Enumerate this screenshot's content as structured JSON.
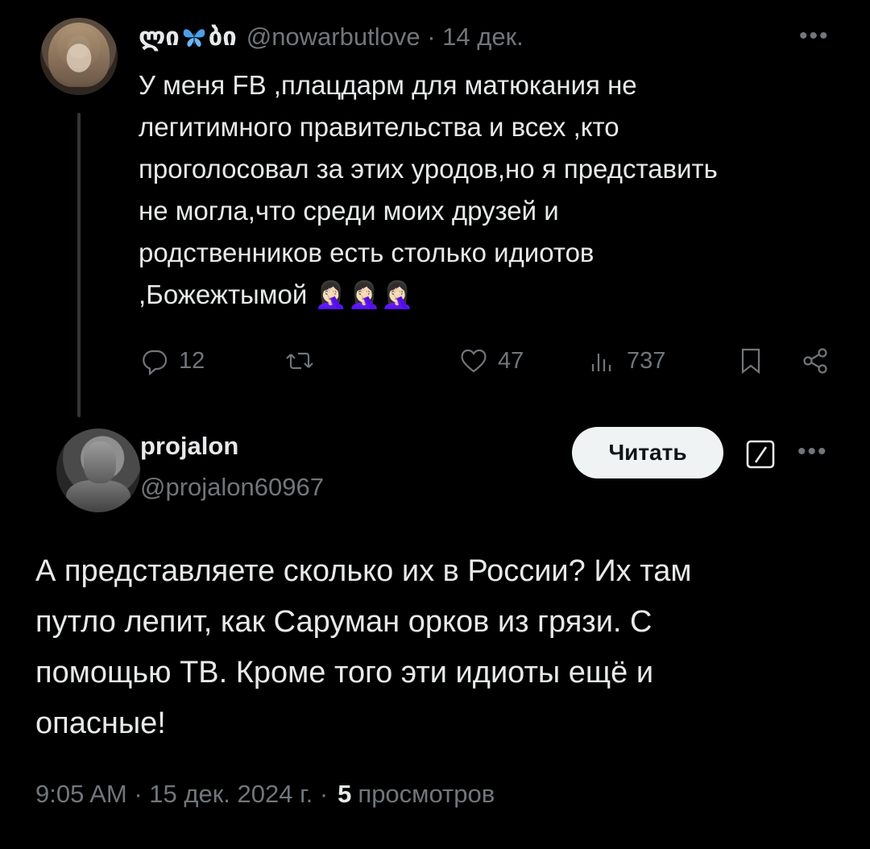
{
  "parent_tweet": {
    "author_name_part1": "ლი",
    "author_name_part2": "ბი",
    "handle": "@nowarbutlove",
    "separator": " · ",
    "date": "14 дек.",
    "text": "У меня FB ,плацдарм для матюкания  не\nлегитимного правительства и всех ,кто\nпроголосовал  за этих уродов,но я представить\nне могла,что среди моих друзей и\nродственников есть столько идиотов\n,Божежтымой 🤦🏻‍♀️🤦🏻‍♀️🤦🏻‍♀️",
    "replies": "12",
    "likes": "47",
    "views": "737",
    "more_label": "•••"
  },
  "reply_tweet": {
    "author_name": "projalon",
    "handle": "@projalon60967",
    "follow_label": "Читать",
    "more_label": "•••",
    "text": "А представляете сколько их в России? Их там\nпутло лепит, как Саруман орков из грязи. С\nпомощью ТВ. Кроме того эти идиоты ещё и\nопасные!",
    "time_date": "9:05 AM · 15 дек. 2024 г. · ",
    "views_count": "5",
    "views_label": "просмотров"
  },
  "colors": {
    "background": "#000000",
    "text_primary": "#e7e9ea",
    "text_secondary": "#71767b",
    "button_bg": "#eff3f4",
    "butterfly": "#4a9fe8"
  },
  "icons": [
    "reply-icon",
    "retweet-icon",
    "like-icon",
    "views-icon",
    "bookmark-icon",
    "share-icon",
    "grok-icon",
    "more-icon",
    "butterfly-icon"
  ]
}
